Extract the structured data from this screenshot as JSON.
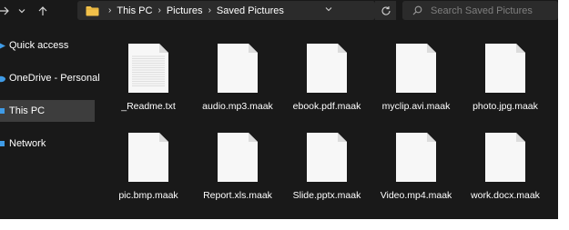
{
  "colors": {
    "window_background": "#191919",
    "field_background": "#2b2b2b",
    "selected_background": "#3d3d3d",
    "folder_yellow": "#f2c14a",
    "link_blue": "#3f9be6",
    "text": "#ffffff",
    "placeholder_text": "#7f7f7f"
  },
  "toolbar": {
    "back_icon": "arrow-right-icon",
    "recent_icon": "chevron-down-icon",
    "up_icon": "arrow-up-icon",
    "address": {
      "folder_icon": "folder-icon",
      "breadcrumbs": [
        "This PC",
        "Pictures",
        "Saved Pictures"
      ],
      "dropdown_icon": "chevron-down-icon"
    },
    "refresh_icon": "refresh-icon",
    "search": {
      "icon": "search-icon",
      "placeholder": "Search Saved Pictures"
    }
  },
  "sidebar": {
    "items": [
      {
        "label": "Quick access",
        "icon": "quick-access-icon",
        "selected": false
      },
      {
        "label": "OneDrive - Personal",
        "icon": "onedrive-icon",
        "selected": false
      },
      {
        "label": "This PC",
        "icon": "this-pc-icon",
        "selected": true
      },
      {
        "label": "Network",
        "icon": "network-icon",
        "selected": false
      }
    ]
  },
  "files": [
    {
      "name": "_Readme.txt",
      "icon": "text-document-icon"
    },
    {
      "name": "audio.mp3.maak",
      "icon": "blank-file-icon"
    },
    {
      "name": "ebook.pdf.maak",
      "icon": "blank-file-icon"
    },
    {
      "name": "myclip.avi.maak",
      "icon": "blank-file-icon"
    },
    {
      "name": "photo.jpg.maak",
      "icon": "blank-file-icon"
    },
    {
      "name": "pic.bmp.maak",
      "icon": "blank-file-icon"
    },
    {
      "name": "Report.xls.maak",
      "icon": "blank-file-icon"
    },
    {
      "name": "Slide.pptx.maak",
      "icon": "blank-file-icon"
    },
    {
      "name": "Video.mp4.maak",
      "icon": "blank-file-icon"
    },
    {
      "name": "work.docx.maak",
      "icon": "blank-file-icon"
    }
  ]
}
